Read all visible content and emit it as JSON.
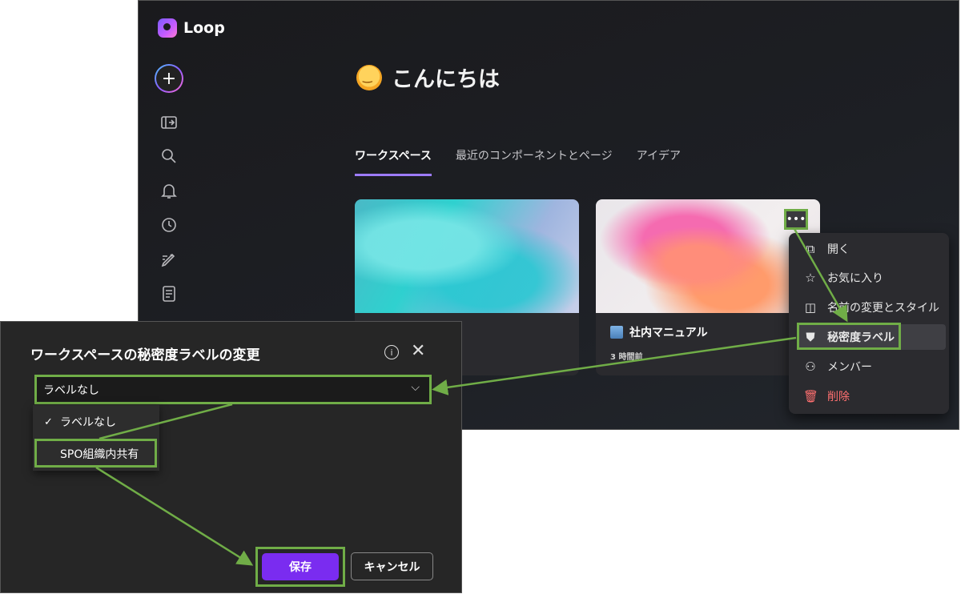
{
  "app": {
    "name": "Loop",
    "greeting": "こんにちは",
    "tabs": [
      {
        "label": "ワークスペース",
        "active": true
      },
      {
        "label": "最近のコンポーネントとページ",
        "active": false
      },
      {
        "label": "アイデア",
        "active": false
      }
    ],
    "sidebar_icons": [
      "plus-icon",
      "panel-icon",
      "search-icon",
      "bell-icon",
      "clock-icon",
      "pen-icon",
      "document-icon"
    ],
    "cards": [
      {
        "title": "",
        "time": ""
      },
      {
        "title": "社内マニュアル",
        "time": "3 時間前"
      }
    ],
    "more_label": "•••",
    "context_menu": [
      {
        "label": "開く",
        "icon": "open-icon"
      },
      {
        "label": "お気に入り",
        "icon": "star-icon"
      },
      {
        "label": "名前の変更とスタイル",
        "icon": "rename-icon"
      },
      {
        "label": "秘密度ラベル",
        "icon": "shield-icon",
        "highlighted": true
      },
      {
        "label": "メンバー",
        "icon": "people-icon"
      },
      {
        "label": "削除",
        "icon": "trash-icon",
        "danger": true
      }
    ]
  },
  "dialog": {
    "title": "ワークスペースの秘密度ラベルの変更",
    "selected_value": "ラベルなし",
    "options": [
      {
        "label": "ラベルなし",
        "checked": true
      },
      {
        "label": "SPO組織内共有",
        "checked": false
      }
    ],
    "save_label": "保存",
    "cancel_label": "キャンセル"
  },
  "colors": {
    "accent": "#7a2cf0",
    "annotation": "#70ad47",
    "tab_underline": "#9d7bff",
    "danger": "#ff7070"
  }
}
